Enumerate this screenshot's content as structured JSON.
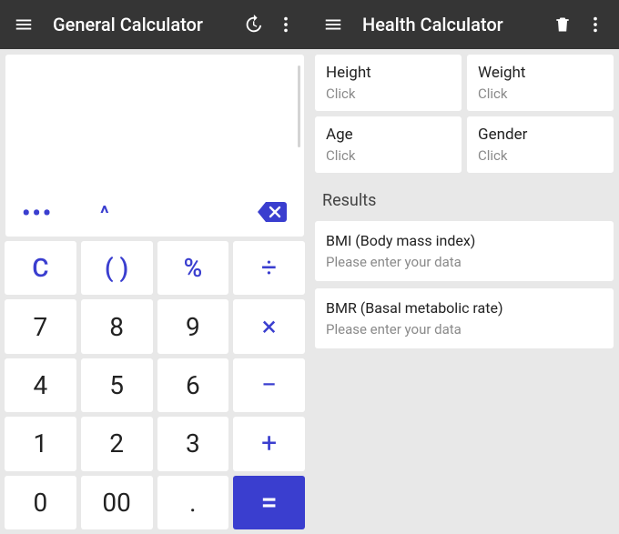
{
  "left": {
    "title": "General Calculator",
    "secondary": {
      "ellipsis": "•••",
      "caret": "^"
    },
    "keys": {
      "clear": "C",
      "paren": "( )",
      "percent": "%",
      "divide": "÷",
      "n7": "7",
      "n8": "8",
      "n9": "9",
      "multiply": "×",
      "n4": "4",
      "n5": "5",
      "n6": "6",
      "minus": "−",
      "n1": "1",
      "n2": "2",
      "n3": "3",
      "plus": "+",
      "n0": "0",
      "n00": "00",
      "dot": ".",
      "equals": "="
    }
  },
  "right": {
    "title": "Health Calculator",
    "inputs": [
      {
        "label": "Height",
        "hint": "Click"
      },
      {
        "label": "Weight",
        "hint": "Click"
      },
      {
        "label": "Age",
        "hint": "Click"
      },
      {
        "label": "Gender",
        "hint": "Click"
      }
    ],
    "results_header": "Results",
    "results": [
      {
        "title": "BMI (Body mass index)",
        "sub": "Please enter your data"
      },
      {
        "title": "BMR (Basal metabolic rate)",
        "sub": "Please enter your data"
      }
    ]
  }
}
